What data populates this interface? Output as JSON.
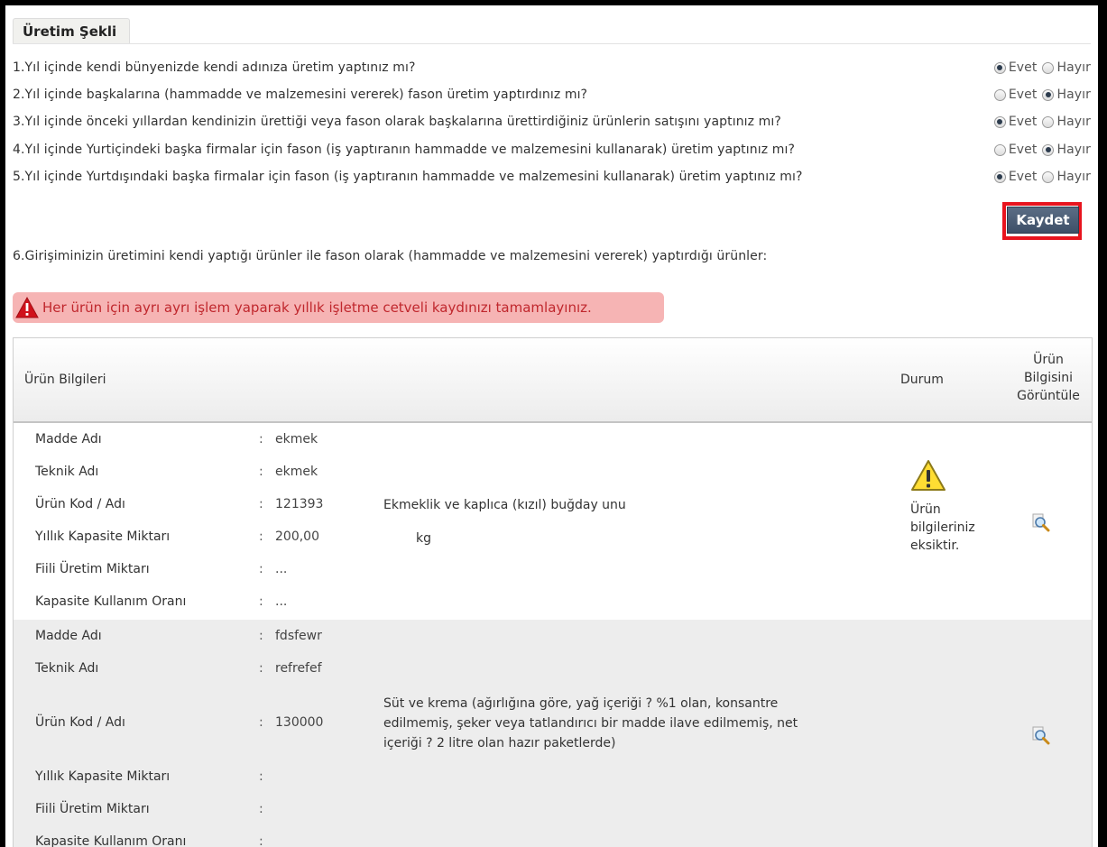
{
  "section_title": "Üretim Şekli",
  "radio_yes": "Evet",
  "radio_no": "Hayır",
  "questions": [
    {
      "text": "1.Yıl içinde kendi bünyenizde kendi adınıza üretim yaptınız mı?",
      "selected": "Evet"
    },
    {
      "text": "2.Yıl içinde başkalarına (hammadde ve malzemesini vererek) fason üretim yaptırdınız mı?",
      "selected": "Hayır"
    },
    {
      "text": "3.Yıl içinde önceki yıllardan kendinizin ürettiği veya fason olarak başkalarına ürettirdiğiniz ürünlerin satışını yaptınız mı?",
      "selected": "Evet"
    },
    {
      "text": "4.Yıl içinde Yurtiçindeki başka firmalar için fason (iş yaptıranın hammadde ve malzemesini kullanarak) üretim yaptınız mı?",
      "selected": "Hayır"
    },
    {
      "text": "5.Yıl içinde Yurtdışındaki başka firmalar için fason (iş yaptıranın hammadde ve malzemesini kullanarak) üretim yaptınız mı?",
      "selected": "Evet"
    }
  ],
  "save_label": "Kaydet",
  "q6_text": "6.Girişiminizin üretimini kendi yaptığı ürünler ile fason olarak (hammadde ve malzemesini vererek) yaptırdığı ürünler:",
  "alert_text": "Her ürün için ayrı ayrı işlem yaparak yıllık işletme cetveli kaydınızı tamamlayınız.",
  "table": {
    "col_info": "Ürün Bilgileri",
    "col_status": "Durum",
    "col_view": [
      "Ürün",
      "Bilgisini",
      "Görüntüle"
    ],
    "labels": [
      "Madde Adı",
      "Teknik Adı",
      "Ürün Kod / Adı",
      "Yıllık Kapasite Miktarı",
      "Fiili Üretim Miktarı",
      "Kapasite Kullanım Oranı"
    ],
    "colon": ":",
    "rows": [
      {
        "madde_adi": "ekmek",
        "teknik_adi": "ekmek",
        "urun_kod": "121393",
        "urun_adi": "Ekmeklik ve kaplıca (kızıl) buğday unu",
        "kapasite": "200,00",
        "unit": "kg",
        "fiili": "...",
        "oran": "...",
        "status_lines": [
          "Ürün",
          "bilgileriniz",
          "eksiktir."
        ],
        "status_icon": "warning-icon",
        "view_icon": "magnifier-icon"
      },
      {
        "madde_adi": "fdsfewr",
        "teknik_adi": "refrefef",
        "urun_kod": "130000",
        "urun_adi_lines": [
          "Süt ve krema (ağırlığına göre, yağ içeriği ? %1 olan, konsantre",
          "edilmemiş, şeker veya tatlandırıcı bir madde ilave edilmemiş, net",
          "içeriği ? 2 litre olan hazır paketlerde)"
        ],
        "kapasite": "",
        "fiili": "",
        "oran": "",
        "view_icon": "magnifier-icon"
      }
    ]
  },
  "colors": {
    "alert_bg": "#f6b4b4",
    "alert_text": "#c0272d",
    "button": "#4a5b73",
    "highlight_border": "#e8141e"
  }
}
